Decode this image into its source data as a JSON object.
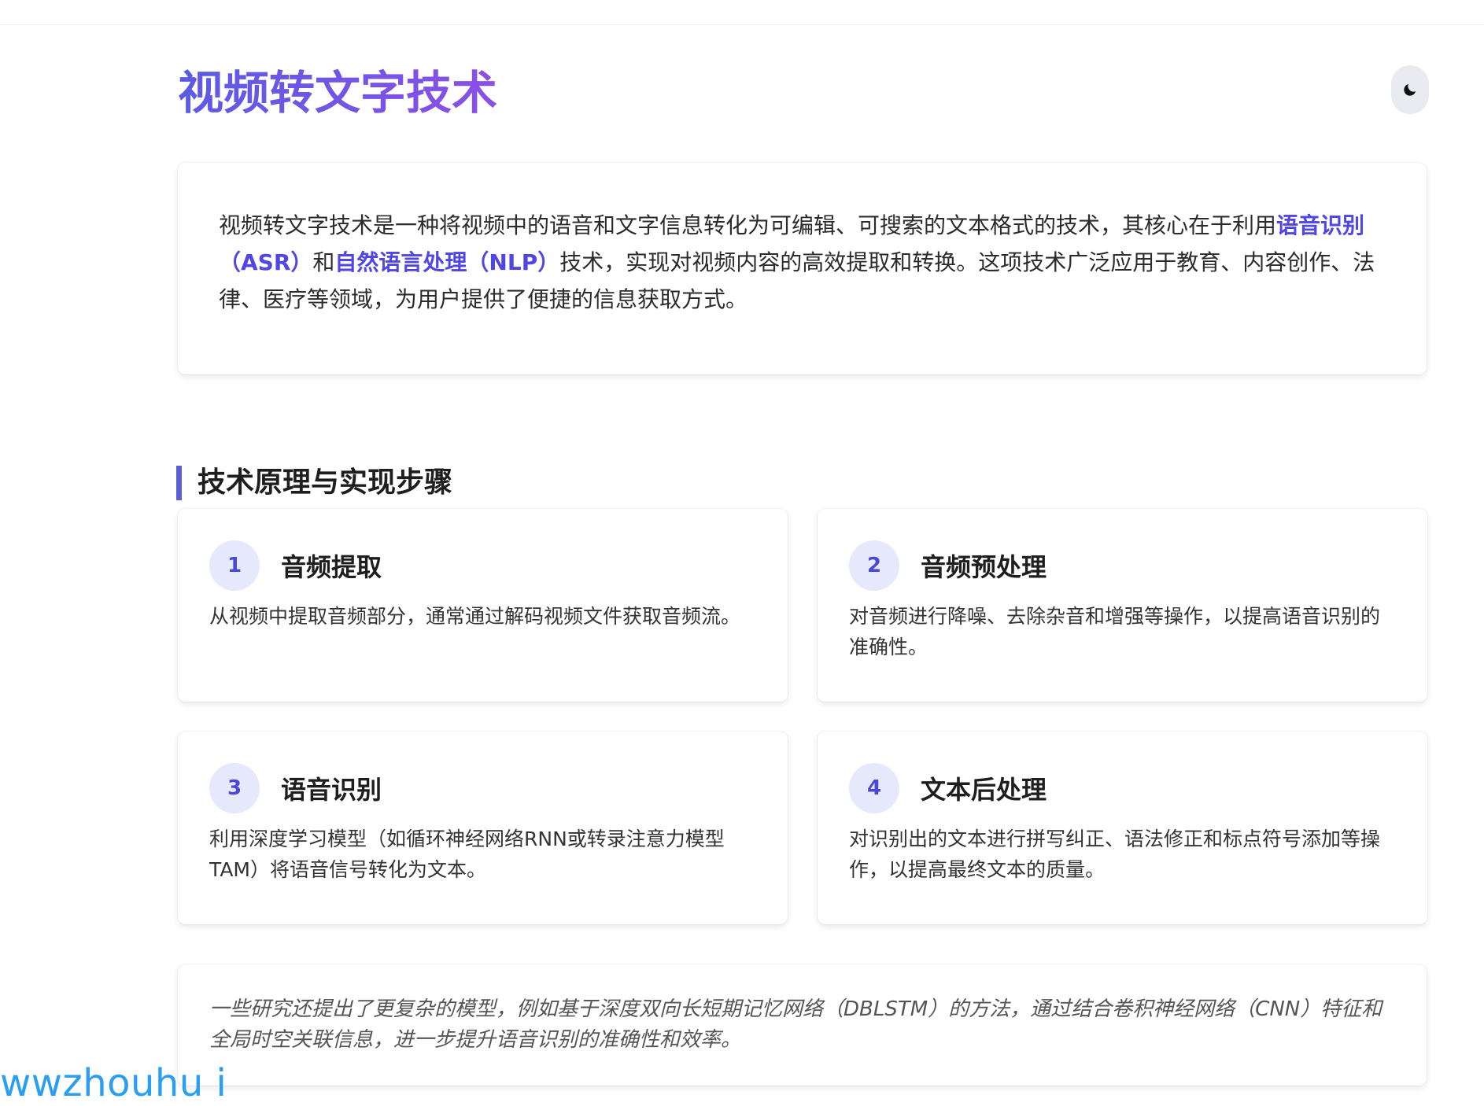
{
  "header": {
    "title": "视频转文字技术",
    "theme_toggle_icon": "moon-icon"
  },
  "intro": {
    "before": "视频转文字技术是一种将视频中的语音和文字信息转化为可编辑、可搜索的文本格式的技术，其核心在于利用",
    "term_asr": "语音识别（ASR）",
    "and": "和",
    "term_nlp": "自然语言处理（NLP）",
    "after": "技术，实现对视频内容的高效提取和转换。这项技术广泛应用于教育、内容创作、法律、医疗等领域，为用户提供了便捷的信息获取方式。"
  },
  "section": {
    "heading": "技术原理与实现步骤"
  },
  "steps": [
    {
      "num": "1",
      "title": "音频提取",
      "desc": "从视频中提取音频部分，通常通过解码视频文件获取音频流。"
    },
    {
      "num": "2",
      "title": "音频预处理",
      "desc": "对音频进行降噪、去除杂音和增强等操作，以提高语音识别的准确性。"
    },
    {
      "num": "3",
      "title": "语音识别",
      "desc": "利用深度学习模型（如循环神经网络RNN或转录注意力模型TAM）将语音信号转化为文本。"
    },
    {
      "num": "4",
      "title": "文本后处理",
      "desc": "对识别出的文本进行拼写纠正、语法修正和标点符号添加等操作，以提高最终文本的质量。"
    }
  ],
  "note": {
    "text": "一些研究还提出了更复杂的模型，例如基于深度双向长短期记忆网络（DBLSTM）的方法，通过结合卷积神经网络（CNN）特征和全局时空关联信息，进一步提升语音识别的准确性和效率。"
  },
  "watermark": "wwzhouhu i",
  "colors": {
    "accent": "#4f46e5",
    "title_gradient_start": "#5b5be6",
    "title_gradient_end": "#8b4fe6",
    "step_badge_bg": "#e6e8fb",
    "section_bar": "#5b5fd6",
    "watermark": "#2a9ef0"
  }
}
